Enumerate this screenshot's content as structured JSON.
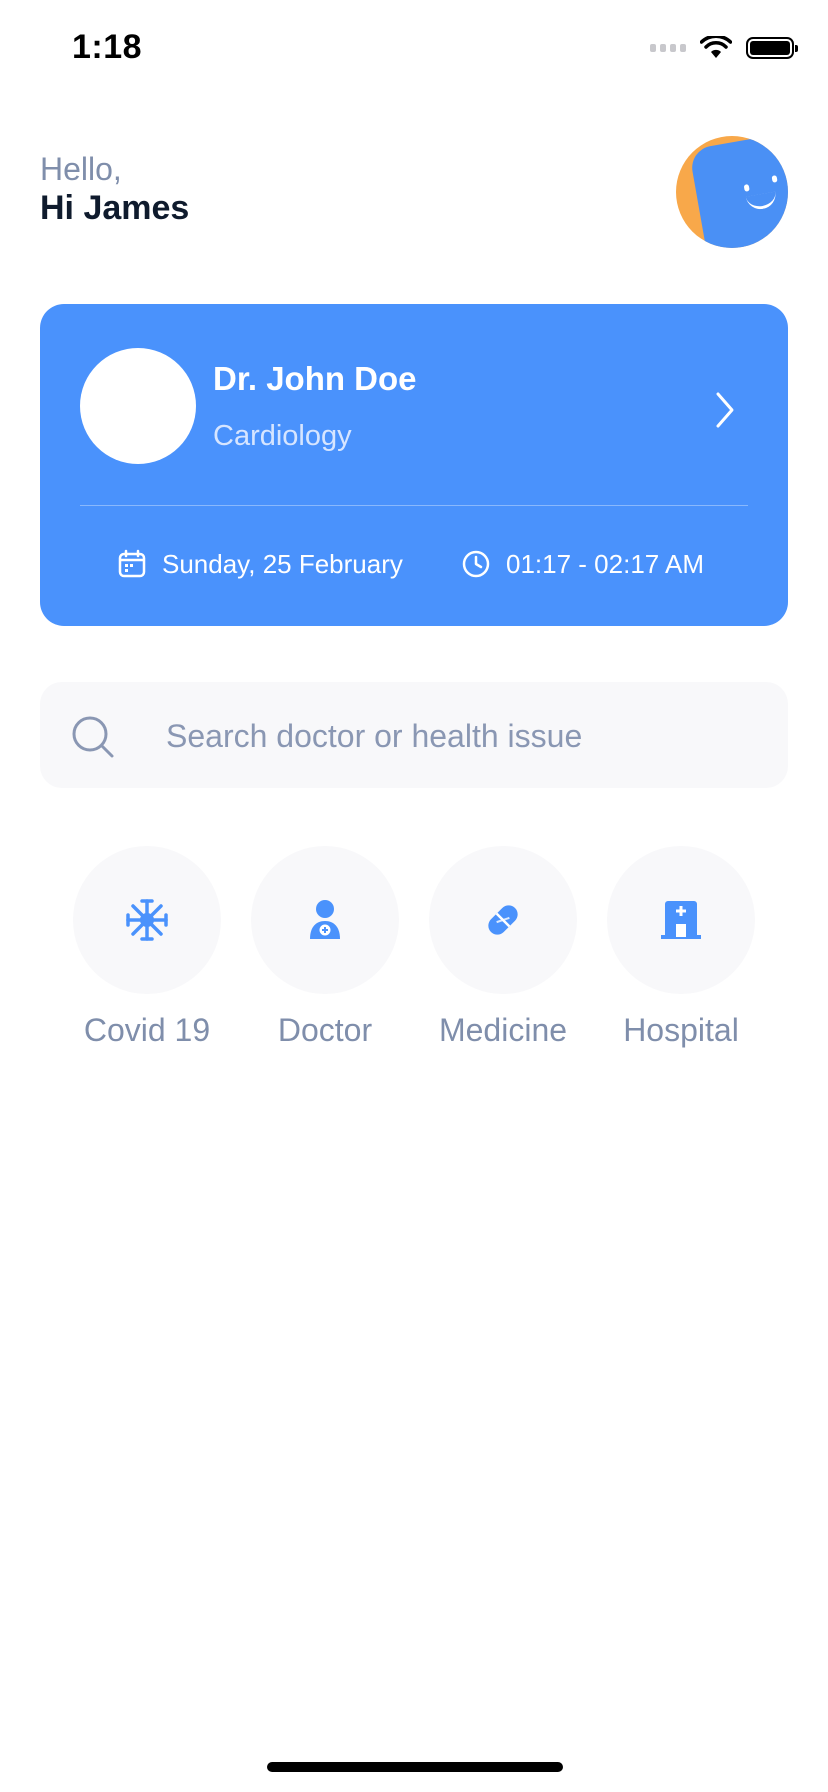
{
  "status_bar": {
    "time": "1:18"
  },
  "header": {
    "hello": "Hello,",
    "name": "Hi James"
  },
  "appointment": {
    "doctor_name": "Dr. John Doe",
    "specialty": "Cardiology",
    "date": "Sunday, 25 February",
    "time": "01:17 - 02:17 AM"
  },
  "search": {
    "placeholder": "Search doctor or health issue",
    "value": ""
  },
  "categories": [
    {
      "label": "Covid 19",
      "icon": "virus-icon"
    },
    {
      "label": "Doctor",
      "icon": "doctor-icon"
    },
    {
      "label": "Medicine",
      "icon": "pill-icon"
    },
    {
      "label": "Hospital",
      "icon": "hospital-icon"
    }
  ],
  "colors": {
    "accent": "#4a92fc",
    "avatar_bg": "#f8a84a",
    "muted_text": "#7f8eab",
    "dark_text": "#0f1b2d",
    "tile_bg": "#f8f8fa"
  }
}
